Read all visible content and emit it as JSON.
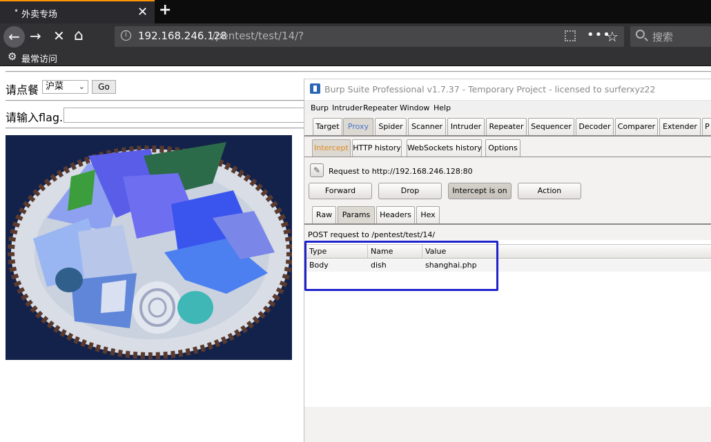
{
  "browser": {
    "tab_title": "外卖专场",
    "tab_dot": "•",
    "tab_close": "✕",
    "new_tab": "+",
    "url_host": "192.168.246.128",
    "url_path": "/pentest/test/14/?",
    "search_placeholder": "搜索",
    "bookmark_label": "最常访问",
    "icons": {
      "back": "←",
      "forward": "→",
      "stop": "✕",
      "home": "⌂",
      "info": "i",
      "more": "•••",
      "star": "☆",
      "gear": "⚙"
    }
  },
  "page": {
    "order_label": "请点餐",
    "dish_selected": "沪菜",
    "go_label": "Go",
    "flag_label": "请输入flag."
  },
  "burp": {
    "title": "Burp Suite Professional v1.7.37 - Temporary Project - licensed to surferxyz22",
    "menu": [
      "Burp",
      "Intruder",
      "Repeater",
      "Window",
      "Help"
    ],
    "main_tabs": [
      "Target",
      "Proxy",
      "Spider",
      "Scanner",
      "Intruder",
      "Repeater",
      "Sequencer",
      "Decoder",
      "Comparer",
      "Extender",
      "P"
    ],
    "active_main_tab": "Proxy",
    "proxy_tabs": [
      "Intercept",
      "HTTP history",
      "WebSockets history",
      "Options"
    ],
    "active_proxy_tab": "Intercept",
    "request_label": "Request to http://192.168.246.128:80",
    "buttons": {
      "forward": "Forward",
      "drop": "Drop",
      "intercept": "Intercept is on",
      "action": "Action"
    },
    "view_tabs": [
      "Raw",
      "Params",
      "Headers",
      "Hex"
    ],
    "active_view_tab": "Params",
    "post_label": "POST request to /pentest/test/14/",
    "table": {
      "columns": [
        "Type",
        "Name",
        "Value"
      ],
      "rows": [
        {
          "type": "Body",
          "name": "dish",
          "value": "shanghai.php"
        }
      ]
    },
    "accent_color": "#e38a1b",
    "highlight_color": "#1f22cc"
  }
}
